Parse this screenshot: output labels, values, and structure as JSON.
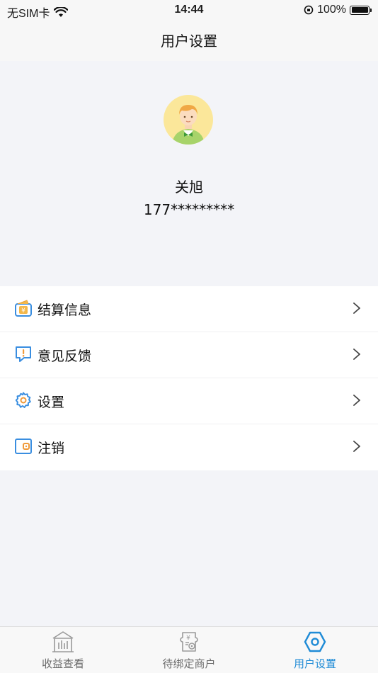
{
  "status_bar": {
    "carrier": "无SIM卡",
    "time": "14:44",
    "battery": "100%"
  },
  "nav": {
    "title": "用户设置"
  },
  "profile": {
    "name": "关旭",
    "phone": "177*********"
  },
  "menu": {
    "items": [
      {
        "label": "结算信息",
        "icon": "wallet-yuan-icon"
      },
      {
        "label": "意见反馈",
        "icon": "feedback-icon"
      },
      {
        "label": "设置",
        "icon": "gear-icon"
      },
      {
        "label": "注销",
        "icon": "logout-card-icon"
      }
    ]
  },
  "tab_bar": {
    "tabs": [
      {
        "label": "收益查看",
        "icon": "earnings-building-icon"
      },
      {
        "label": "待绑定商户",
        "icon": "merchant-bind-icon"
      },
      {
        "label": "用户设置",
        "icon": "hexagon-settings-icon",
        "active": true
      }
    ]
  },
  "colors": {
    "accent": "#1f8bd6",
    "background": "#f3f4f8",
    "avatar_bg": "#fbe79a"
  }
}
